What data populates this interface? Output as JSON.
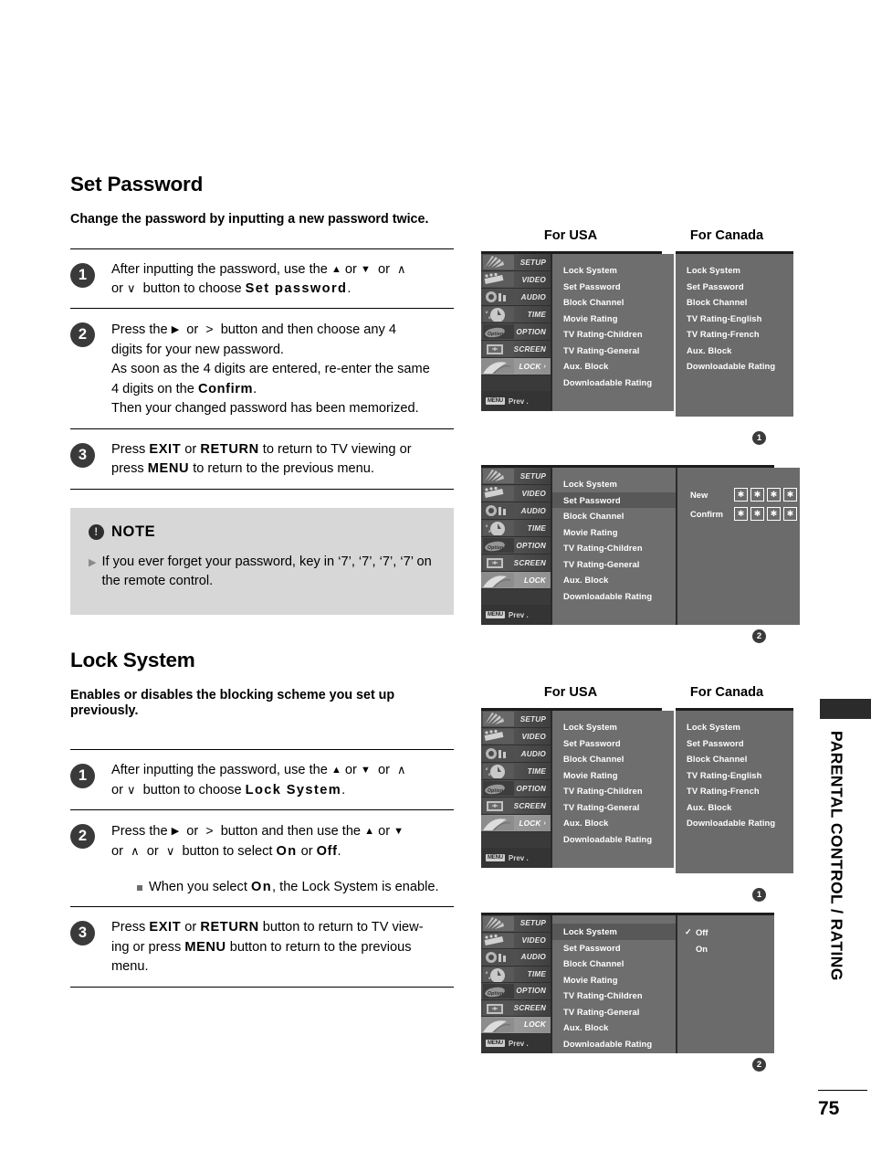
{
  "page": {
    "number": "75",
    "edge_tab_label": "PARENTAL CONTROL / RATING"
  },
  "sections": [
    {
      "title": "Set Password",
      "subtitle": "Change the password by inputting a new password twice.",
      "steps": [
        {
          "num": "1",
          "lines": [
            "After inputting the password, use the ▲ or ▼  or ∧ or ∨  button to choose Set password."
          ],
          "bold_terms": [
            "Set password"
          ]
        },
        {
          "num": "2",
          "lines": [
            "Press the ▶ or > button and then choose any 4 digits for your new password.",
            "As soon as the 4 digits are entered, re-enter the same 4 digits on the Confirm.",
            "Then your changed password has been memorized."
          ],
          "bold_terms": [
            "Confirm"
          ]
        },
        {
          "num": "3",
          "lines": [
            "Press EXIT or RETURN to return to TV viewing or press MENU to return to the previous menu."
          ],
          "bold_terms": [
            "EXIT",
            "RETURN",
            "MENU"
          ]
        }
      ]
    },
    {
      "title": "Lock System",
      "subtitle": "Enables or disables the blocking scheme you set up previously.",
      "steps": [
        {
          "num": "1",
          "lines": [
            "After inputting the password, use the ▲ or ▼  or ∧ or ∨  button to choose Lock System."
          ],
          "bold_terms": [
            "Lock System"
          ]
        },
        {
          "num": "2",
          "lines": [
            "Press the ▶ or > button and then use the ▲ or ▼ or ∧ or ∨ button to select On or Off."
          ],
          "bold_terms": [
            "On",
            "Off"
          ],
          "sub_bullet": "When you select On, the Lock System is enable."
        },
        {
          "num": "3",
          "lines": [
            "Press EXIT or RETURN button to return to TV viewing or press MENU button to return to the previous menu."
          ],
          "bold_terms": [
            "EXIT",
            "RETURN",
            "MENU"
          ]
        }
      ]
    }
  ],
  "note": {
    "icon": "exclamation-icon",
    "title": "NOTE",
    "bullet_arrow": "▶",
    "text": "If you ever forget your password, key in ‘7’, ‘7’, ‘7’, ‘7’ on the remote control."
  },
  "text_labels": {
    "step1_l1_a": "After inputting the password, use the",
    "step1_or": "or",
    "step1_l2_a": "button to choose",
    "step1_target_set": "Set password",
    "step1_target_lock": "Lock System",
    "step2a_press": "Press the",
    "step2a_rest": "button and then choose any 4",
    "step2a_line2": "digits for your new password.",
    "step2a_line3": "As soon as the 4 digits are entered, re-enter the same",
    "step2a_line4a": "4 digits on the",
    "step2a_confirm": "Confirm",
    "step2a_line5": "Then your changed password has been memorized.",
    "step3a_press": "Press",
    "step3a_exit": "EXIT",
    "step3a_return": "RETURN",
    "step3a_mid": "to return to TV viewing or",
    "step3a_press2": "press",
    "step3a_menu": "MENU",
    "step3a_end": "to return to the previous menu.",
    "step2b_rest": "button and then use the",
    "step2b_line2a": "or",
    "step2b_line2b": "button to select",
    "on": "On",
    "off": "Off",
    "step2b_bullet_a": "When you select",
    "step2b_bullet_b": ", the Lock System is enable.",
    "step3b_mid": "button to return to TV view-",
    "step3b_press2": "ing or press",
    "step3b_end": "button to return to the previous",
    "step3b_end2": "menu.",
    "period": ".",
    "comma": ","
  },
  "osd": {
    "header_usa": "For USA",
    "header_canada": "For Canada",
    "rail": [
      {
        "label": "SETUP",
        "icon": "setup-icon"
      },
      {
        "label": "VIDEO",
        "icon": "video-icon"
      },
      {
        "label": "AUDIO",
        "icon": "audio-icon"
      },
      {
        "label": "TIME",
        "icon": "time-icon"
      },
      {
        "label": "OPTION",
        "icon": "option-icon"
      },
      {
        "label": "SCREEN",
        "icon": "screen-icon"
      },
      {
        "label": "LOCK",
        "icon": "lock-icon"
      }
    ],
    "rail_active": "LOCK",
    "rail_arrow": "›",
    "footer_chip": "MENU",
    "footer_text": "Prev .",
    "usa_items": [
      "Lock System",
      "Set Password",
      "Block Channel",
      "Movie Rating",
      "TV Rating-Children",
      "TV Rating-General",
      "Aux. Block",
      "Downloadable Rating"
    ],
    "canada_items": [
      "Lock System",
      "Set Password",
      "Block Channel",
      "TV Rating-English",
      "TV Rating-French",
      "Aux. Block",
      "Downloadable Rating"
    ],
    "sel_arrow": "▶",
    "password": {
      "new_label": "New",
      "confirm_label": "Confirm",
      "mask_char": "✱",
      "field_count": 4
    },
    "lock_options": {
      "check": "✓",
      "items": [
        "Off",
        "On"
      ],
      "selected": "Off"
    },
    "markers": {
      "m1": "1",
      "m2": "2"
    },
    "selected_set_password": "Set Password",
    "selected_lock_system": "Lock System"
  }
}
